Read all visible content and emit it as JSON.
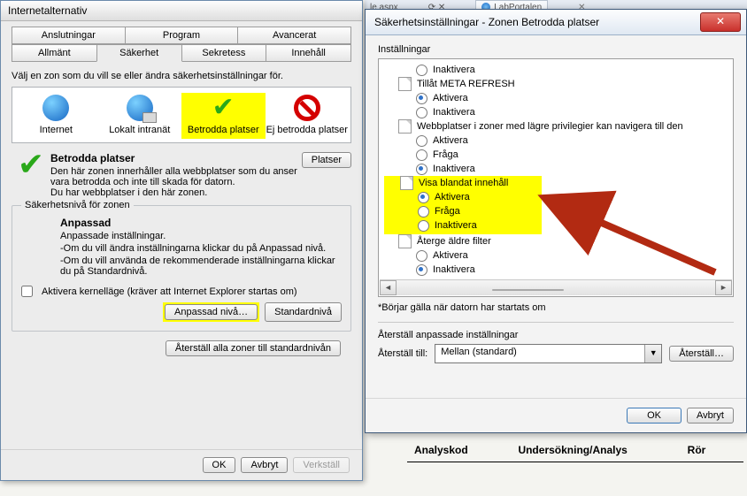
{
  "left": {
    "title": "Internetalternativ",
    "tabs_top": [
      "Anslutningar",
      "Program",
      "Avancerat"
    ],
    "tabs_bottom": [
      "Allmänt",
      "Säkerhet",
      "Sekretess",
      "Innehåll"
    ],
    "active_tab": "Säkerhet",
    "prompt": "Välj en zon som du vill se eller ändra säkerhetsinställningar för.",
    "zones": [
      {
        "label": "Internet"
      },
      {
        "label": "Lokalt intranät"
      },
      {
        "label": "Betrodda platser"
      },
      {
        "label": "Ej betrodda platser"
      }
    ],
    "platser_btn": "Platser",
    "desc_title": "Betrodda platser",
    "desc_body1": "Den här zonen innerhåller alla webbplatser som du anser vara betrodda och inte till skada för datorn.",
    "desc_body2": "Du har webbplatser i den här zonen.",
    "level_legend": "Säkerhetsnivå för zonen",
    "anpassad_title": "Anpassad",
    "anpassad_l1": "Anpassade inställningar.",
    "anpassad_l2": "-Om du vill ändra inställningarna klickar du på Anpassad nivå.",
    "anpassad_l3": "-Om du vill använda de rekommenderade inställningarna klickar du på Standardnivå.",
    "kernel_chk": "Aktivera kernelläge (kräver att Internet Explorer startas om)",
    "btn_anpassad": "Anpassad nivå…",
    "btn_standard": "Standardnivå",
    "btn_reset_all": "Återställ alla zoner till standardnivån",
    "btn_ok": "OK",
    "btn_cancel": "Avbryt",
    "btn_apply": "Verkställ"
  },
  "right": {
    "title": "Säkerhetsinställningar - Zonen Betrodda platser",
    "inst": "Inställningar",
    "tree": {
      "g0_opt0": "Inaktivera",
      "g1": "Tillåt META REFRESH",
      "g1_opt0": "Aktivera",
      "g1_opt1": "Inaktivera",
      "g2": "Webbplatser i zoner med lägre privilegier kan navigera till den",
      "g2_opt0": "Aktivera",
      "g2_opt1": "Fråga",
      "g2_opt2": "Inaktivera",
      "g3": "Visa blandat innehåll",
      "g3_opt0": "Aktivera",
      "g3_opt1": "Fråga",
      "g3_opt2": "Inaktivera",
      "g4": "Återge äldre filter",
      "g4_opt0": "Aktivera",
      "g4_opt1": "Inaktivera"
    },
    "note": "*Börjar gälla när datorn har startats om",
    "reset_legend": "Återställ anpassade inställningar",
    "reset_label": "Återställ till:",
    "reset_value": "Mellan (standard)",
    "btn_reset": "Återställ…",
    "btn_ok": "OK",
    "btn_cancel": "Avbryt"
  },
  "bgtab": {
    "url": "le.aspx",
    "icons": "⟳ ✕",
    "tabname": "LabPortalen",
    "tabclose": "✕"
  },
  "tbl": {
    "c1": "Analyskod",
    "c2": "Undersökning/Analys",
    "c3": "Rör"
  }
}
